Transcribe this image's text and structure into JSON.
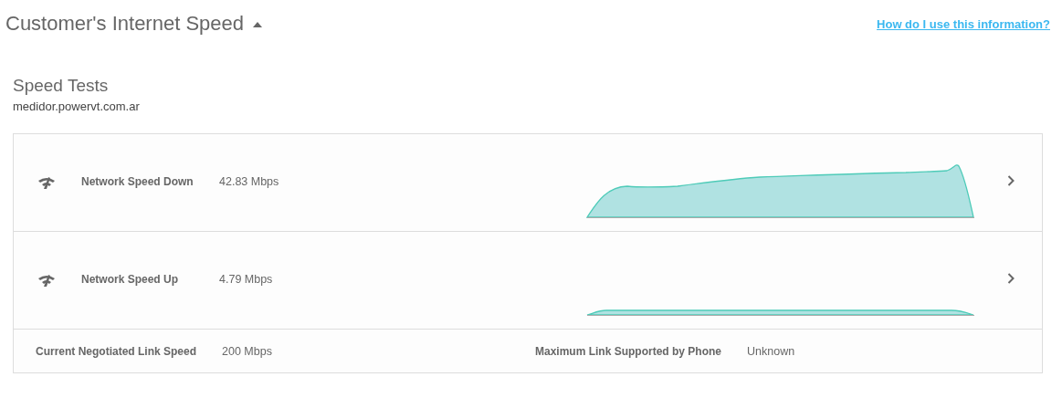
{
  "header": {
    "title": "Customer's Internet Speed",
    "expanded": true,
    "help_link": "How do I use this information?"
  },
  "section": {
    "title": "Speed Tests",
    "server": "medidor.powervt.com.ar"
  },
  "tests": [
    {
      "name": "Network Speed Down",
      "value": "42.83 Mbps"
    },
    {
      "name": "Network Speed Up",
      "value": "4.79 Mbps"
    }
  ],
  "footer": [
    {
      "label": "Current Negotiated Link Speed",
      "value": "200 Mbps"
    },
    {
      "label": "Maximum Link Supported by Phone",
      "value": "Unknown"
    }
  ]
}
